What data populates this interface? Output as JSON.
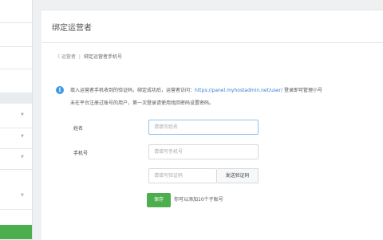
{
  "panel": {
    "title": "绑定运营者"
  },
  "breadcrumb": {
    "back_label": "〈 运营者",
    "current": "绑定运营者手机号"
  },
  "notice": {
    "line1_text": "填入运营者手机收到的验证码，绑定成功后，运营者访问：",
    "line1_url": "https://panel.myhostadmin.net/user/",
    "line1_tail": " 登录即可管理小号",
    "line2": "未在平台注册过账号的用户，第一次登录请使用找回密码设置密码。"
  },
  "form": {
    "name_label": "姓名",
    "name_placeholder": "请填写姓名",
    "phone_label": "手机号",
    "phone_placeholder": "请填写手机号",
    "code_placeholder": "请填写验证码",
    "send_code_label": "发送验证码",
    "save_label": "保存",
    "hint": "你可以添加10个子账号"
  },
  "colors": {
    "accent": "#4cae4c",
    "info": "#3b9be8",
    "link": "#3b7fd4"
  }
}
